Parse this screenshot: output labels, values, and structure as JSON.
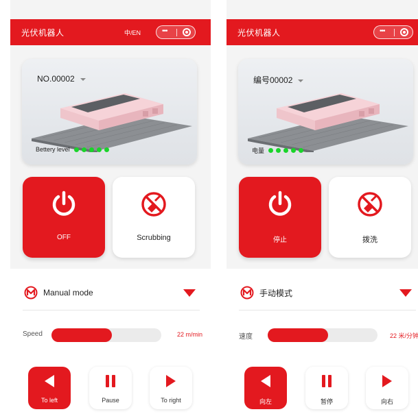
{
  "colors": {
    "accent": "#e3191f",
    "battery_dot": "#19d42a"
  },
  "screens": [
    {
      "header": {
        "title": "光伏机器人",
        "lang_toggle": "中/EN"
      },
      "capsule": {
        "more_icon": "more-dots-icon",
        "close_icon": "target-circle-icon"
      },
      "robot": {
        "device_label": "NO.00002",
        "battery_label": "Bettery level",
        "battery_level": 5
      },
      "power_tile": {
        "label": "OFF",
        "icon": "power-icon"
      },
      "scrub_tile": {
        "label": "Scrubbing",
        "icon": "brush-icon"
      },
      "mode": {
        "label": "Manual mode",
        "icon": "m-logo-icon"
      },
      "speed": {
        "label": "Speed",
        "value": "22",
        "unit": "m/min",
        "fill": 0.55
      },
      "direction": {
        "left_label": "To left",
        "pause_label": "Pause",
        "right_label": "To right"
      }
    },
    {
      "header": {
        "title": "光伏机器人",
        "lang_toggle": ""
      },
      "capsule": {
        "more_icon": "more-dots-icon",
        "close_icon": "target-circle-icon"
      },
      "robot": {
        "device_label": "编号00002",
        "battery_label": "电量",
        "battery_level": 5
      },
      "power_tile": {
        "label": "停止",
        "icon": "power-icon"
      },
      "scrub_tile": {
        "label": "拨洗",
        "icon": "brush-icon"
      },
      "mode": {
        "label": "手动模式",
        "icon": "m-logo-icon"
      },
      "speed": {
        "label": "速度",
        "value": "22",
        "unit": "米/分钟",
        "fill": 0.55
      },
      "direction": {
        "left_label": "向左",
        "pause_label": "暂停",
        "right_label": "向右"
      }
    }
  ]
}
